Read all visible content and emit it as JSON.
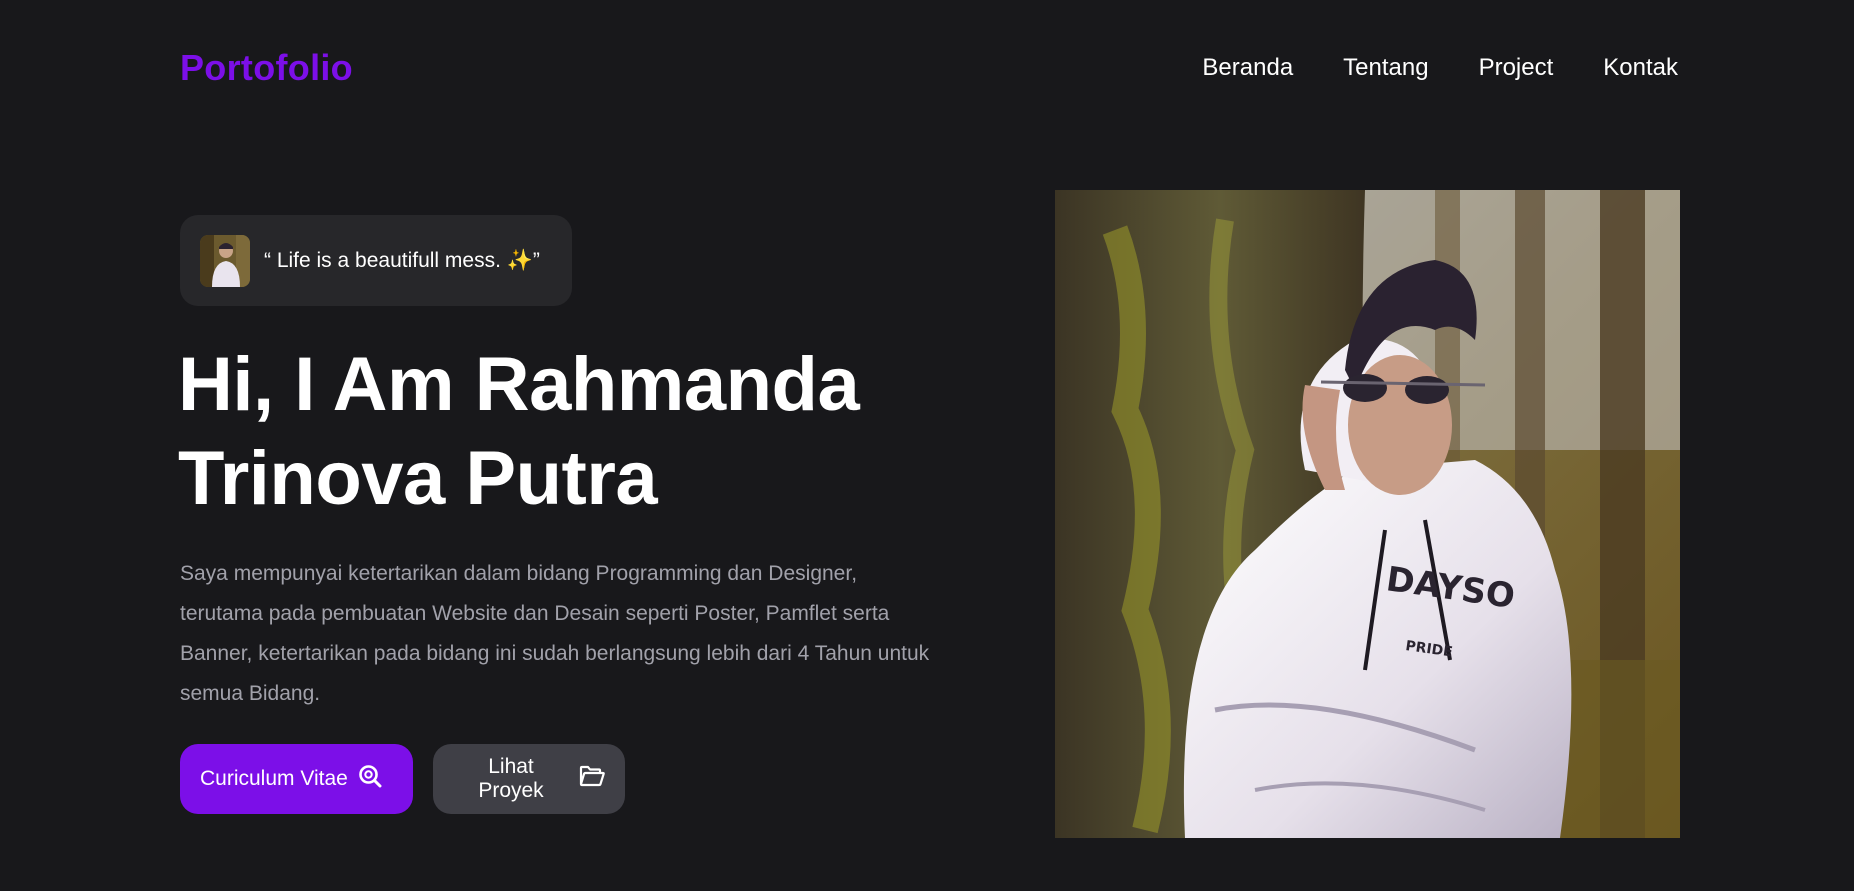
{
  "header": {
    "logo": "Portofolio",
    "nav": [
      "Beranda",
      "Tentang",
      "Project",
      "Kontak"
    ]
  },
  "hero": {
    "quote": "“ Life is a beautifull mess. ✨”",
    "title_line1": "Hi, I Am Rahmanda",
    "title_line2": "Trinova Putra",
    "description": "Saya mempunyai ketertarikan dalam bidang Programming dan Designer, terutama pada pembuatan Website dan Desain seperti Poster, Pamflet serta Banner, ketertarikan pada bidang ini sudah berlangsung lebih dari 4 Tahun untuk semua Bidang.",
    "cv_button": "Curiculum Vitae",
    "cv_icon": "search-icon",
    "project_button": "Lihat Proyek",
    "project_icon": "folder-open-icon"
  },
  "colors": {
    "background": "#18181b",
    "accent": "#7c0fe8",
    "pill": "#27272a",
    "secondary_button": "#3f3f46",
    "muted_text": "#a1a1aa"
  }
}
